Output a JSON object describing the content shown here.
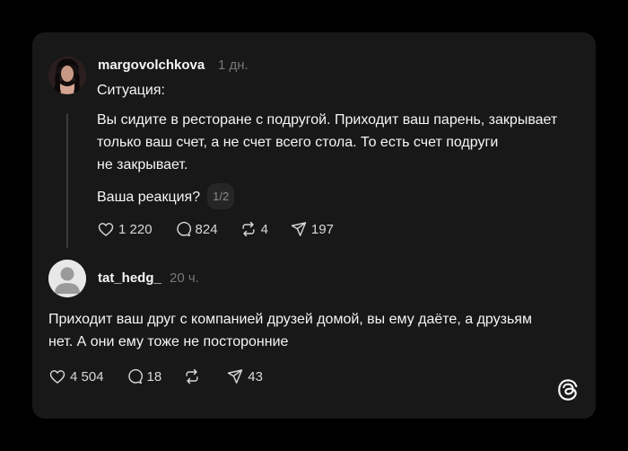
{
  "post": {
    "username": "margovolchkova",
    "time": "1 дн.",
    "line1": "Ситуация:",
    "para": [
      "Вы сидите в ресторане с подругой. Приходит ваш парень, закрывает",
      "только ваш счет, а не счет всего стола. То есть счет подруги",
      "не закрывает."
    ],
    "question": "Ваша реакция?",
    "counter": "1/2",
    "likes": "1 220",
    "comments": "824",
    "reposts": "4",
    "shares": "197"
  },
  "reply": {
    "username": "tat_hedg_",
    "time": "20 ч.",
    "lines": [
      "Приходит ваш друг с компанией друзей домой, вы ему даёте, а друзьям",
      "нет. А они ему тоже не посторонние"
    ],
    "likes": "4 504",
    "comments": "18",
    "shares": "43"
  },
  "icons": {
    "like": "heart-icon",
    "comment": "comment-icon",
    "repost": "repost-icon",
    "share": "send-icon",
    "brand": "threads-logo-icon"
  },
  "colors": {
    "background": "#000000",
    "card": "#181818",
    "text": "#f3f5f7",
    "muted": "#777777"
  }
}
